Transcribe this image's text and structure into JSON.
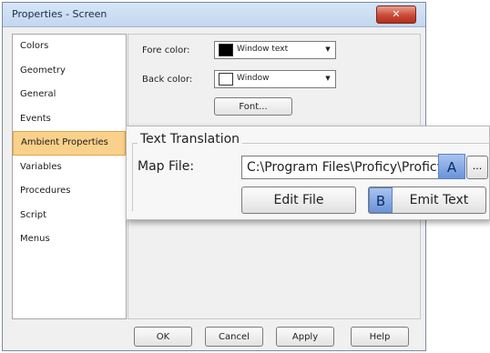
{
  "window": {
    "title": "Properties - Screen",
    "close_glyph": "✕"
  },
  "sidebar": {
    "items": [
      {
        "label": "Colors"
      },
      {
        "label": "Geometry"
      },
      {
        "label": "General"
      },
      {
        "label": "Events"
      },
      {
        "label": "Ambient Properties"
      },
      {
        "label": "Variables"
      },
      {
        "label": "Procedures"
      },
      {
        "label": "Script"
      },
      {
        "label": "Menus"
      }
    ],
    "selected_index": 4,
    "selected_color": "#f9d18a"
  },
  "colors_pane": {
    "fore_label": "Fore color:",
    "fore_value": "Window text",
    "fore_swatch": "#000000",
    "back_label": "Back color:",
    "back_value": "Window",
    "back_swatch": "#ffffff",
    "font_button": "Font..."
  },
  "text_translation": {
    "group_title": "Text Translation",
    "map_file_label": "Map File:",
    "map_file_value": "C:\\Program Files\\Proficy\\Proficy",
    "browse_label": "...",
    "edit_file_button": "Edit File",
    "emit_text_button": "Emit Text",
    "marker_a": "A",
    "marker_b": "B",
    "marker_color": "#6b93d8"
  },
  "dialog_buttons": {
    "ok": "OK",
    "cancel": "Cancel",
    "apply": "Apply",
    "help": "Help"
  },
  "icons": {
    "close": "close-icon",
    "dropdown": "chevron-down-icon"
  }
}
